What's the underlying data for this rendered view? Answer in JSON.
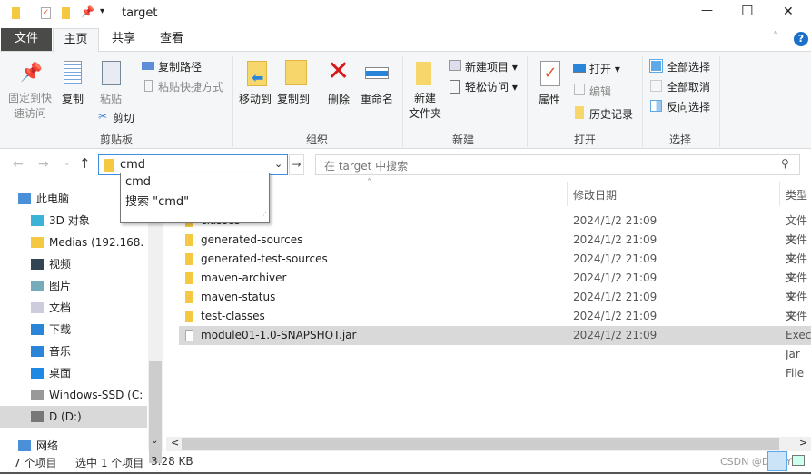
{
  "window": {
    "title": "target",
    "minimize": "—",
    "maximize": "☐",
    "close": "✕"
  },
  "tabs": [
    {
      "label": "文件"
    },
    {
      "label": "主页"
    },
    {
      "label": "共享"
    },
    {
      "label": "查看"
    }
  ],
  "ribbon": {
    "clipboard": {
      "group": "剪贴板",
      "pin": "固定到快",
      "pin2": "速访问",
      "copy": "复制",
      "paste": "粘贴",
      "copy_path": "复制路径",
      "paste_shortcut": "粘贴快捷方式",
      "cut": "剪切"
    },
    "organize": {
      "group": "组织",
      "move_to": "移动到",
      "copy_to": "复制到",
      "delete": "删除",
      "rename": "重命名"
    },
    "new": {
      "group": "新建",
      "new_folder": "新建",
      "new_folder2": "文件夹",
      "new_item": "新建项目",
      "easy_access": "轻松访问"
    },
    "open": {
      "group": "打开",
      "properties": "属性",
      "open": "打开",
      "edit": "编辑",
      "history": "历史记录"
    },
    "select": {
      "group": "选择",
      "select_all": "全部选择",
      "select_none": "全部取消",
      "invert": "反向选择"
    }
  },
  "address": {
    "value": "cmd",
    "suggestions": [
      "cmd",
      "搜索 \"cmd\""
    ]
  },
  "search": {
    "placeholder": "在 target 中搜索"
  },
  "nav": [
    {
      "label": "此电脑"
    },
    {
      "label": "3D 对象"
    },
    {
      "label": "Medias (192.168.3."
    },
    {
      "label": "视频"
    },
    {
      "label": "图片"
    },
    {
      "label": "文档"
    },
    {
      "label": "下载"
    },
    {
      "label": "音乐"
    },
    {
      "label": "桌面"
    },
    {
      "label": "Windows-SSD (C:)"
    },
    {
      "label": "D (D:)"
    },
    {
      "label": "网络"
    }
  ],
  "columns": {
    "date": "修改日期",
    "type": "类型"
  },
  "files": [
    {
      "name": "classes",
      "date": "2024/1/2 21:09",
      "type": "文件夹",
      "folder": true
    },
    {
      "name": "generated-sources",
      "date": "2024/1/2 21:09",
      "type": "文件夹",
      "folder": true
    },
    {
      "name": "generated-test-sources",
      "date": "2024/1/2 21:09",
      "type": "文件夹",
      "folder": true
    },
    {
      "name": "maven-archiver",
      "date": "2024/1/2 21:09",
      "type": "文件夹",
      "folder": true
    },
    {
      "name": "maven-status",
      "date": "2024/1/2 21:09",
      "type": "文件夹",
      "folder": true
    },
    {
      "name": "test-classes",
      "date": "2024/1/2 21:09",
      "type": "文件夹",
      "folder": true
    },
    {
      "name": "module01-1.0-SNAPSHOT.jar",
      "date": "2024/1/2 21:09",
      "type": "Executable Jar File",
      "folder": false,
      "selected": true
    }
  ],
  "status": {
    "count": "7 个项目",
    "selected": "选中 1 个项目",
    "size": "3.28 KB"
  },
  "watermark": "CSDN @DE啊Y"
}
